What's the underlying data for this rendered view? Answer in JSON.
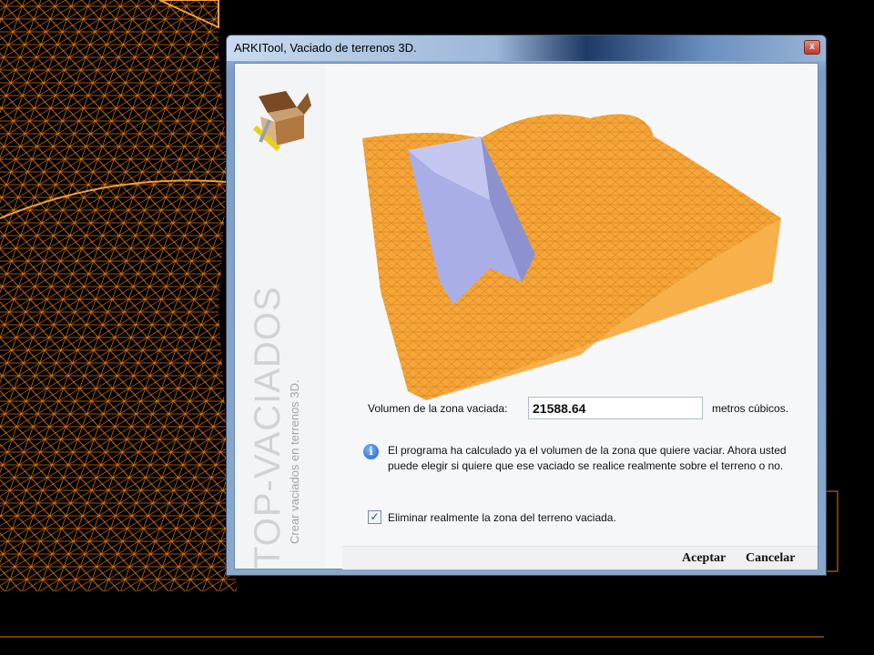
{
  "window": {
    "title": "ARKITool, Vaciado de terrenos 3D.",
    "close_glyph": "x"
  },
  "sidebar": {
    "title": "TOP-VACIADOS",
    "subtitle": "Crear vaciados en terrenos 3D."
  },
  "volume": {
    "label": "Volumen de la zona vaciada:",
    "value": "21588.64",
    "unit": "metros cúbicos."
  },
  "info": {
    "glyph": "i",
    "message": "El programa ha calculado ya el volumen de la zona que quiere vaciar. Ahora usted puede elegir si quiere que ese vaciado se realice realmente sobre el terreno o no."
  },
  "checkbox": {
    "label": "Eliminar realmente la zona del terreno vaciada.",
    "checked": true,
    "glyph": "✓"
  },
  "buttons": {
    "accept": "Aceptar",
    "cancel": "Cancelar"
  },
  "colors": {
    "terrain": "#f5a030",
    "excavation": "#a9aee6",
    "wire": "#e07a10"
  }
}
